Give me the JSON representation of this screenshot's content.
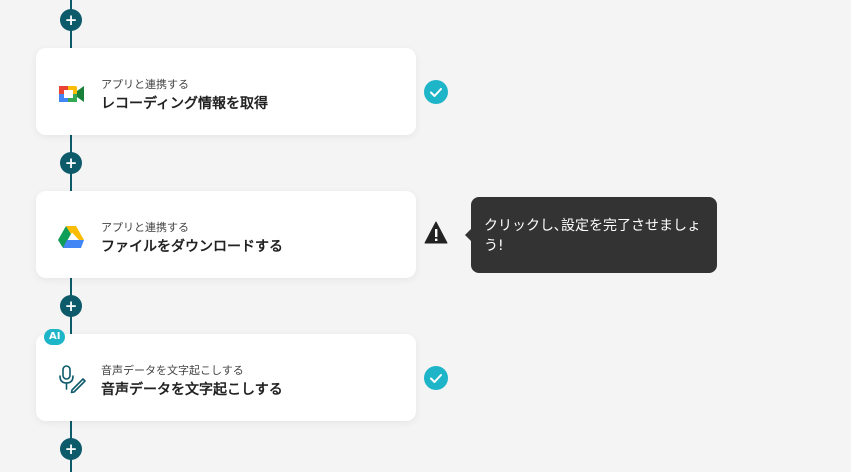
{
  "steps": [
    {
      "category": "アプリと連携する",
      "title": "レコーディング情報を取得",
      "icon": "google-meet-icon",
      "status": "complete"
    },
    {
      "category": "アプリと連携する",
      "title": "ファイルをダウンロードする",
      "icon": "google-drive-icon",
      "status": "warning"
    },
    {
      "category": "音声データを文字起こしする",
      "title": "音声データを文字起こしする",
      "icon": "mic-pen-icon",
      "status": "complete",
      "badge": "AI"
    }
  ],
  "tooltip": "クリックし､設定を完了させましょう!",
  "colors": {
    "line": "#0d5a6b",
    "check": "#1fb5c9",
    "warning": "#222222",
    "tooltip_bg": "#333333"
  }
}
